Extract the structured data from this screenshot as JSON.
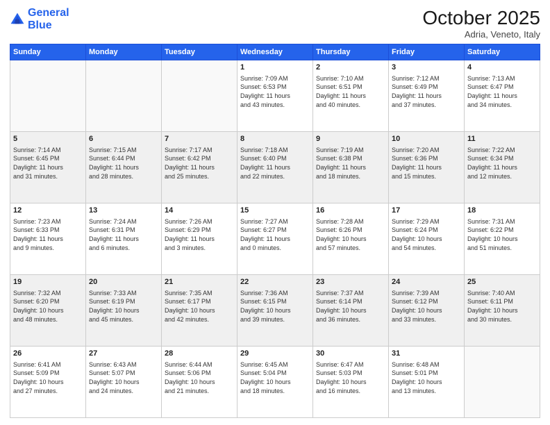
{
  "header": {
    "logo_line1": "General",
    "logo_line2": "Blue",
    "month": "October 2025",
    "location": "Adria, Veneto, Italy"
  },
  "days_of_week": [
    "Sunday",
    "Monday",
    "Tuesday",
    "Wednesday",
    "Thursday",
    "Friday",
    "Saturday"
  ],
  "weeks": [
    [
      {
        "day": "",
        "info": ""
      },
      {
        "day": "",
        "info": ""
      },
      {
        "day": "",
        "info": ""
      },
      {
        "day": "1",
        "info": "Sunrise: 7:09 AM\nSunset: 6:53 PM\nDaylight: 11 hours\nand 43 minutes."
      },
      {
        "day": "2",
        "info": "Sunrise: 7:10 AM\nSunset: 6:51 PM\nDaylight: 11 hours\nand 40 minutes."
      },
      {
        "day": "3",
        "info": "Sunrise: 7:12 AM\nSunset: 6:49 PM\nDaylight: 11 hours\nand 37 minutes."
      },
      {
        "day": "4",
        "info": "Sunrise: 7:13 AM\nSunset: 6:47 PM\nDaylight: 11 hours\nand 34 minutes."
      }
    ],
    [
      {
        "day": "5",
        "info": "Sunrise: 7:14 AM\nSunset: 6:45 PM\nDaylight: 11 hours\nand 31 minutes."
      },
      {
        "day": "6",
        "info": "Sunrise: 7:15 AM\nSunset: 6:44 PM\nDaylight: 11 hours\nand 28 minutes."
      },
      {
        "day": "7",
        "info": "Sunrise: 7:17 AM\nSunset: 6:42 PM\nDaylight: 11 hours\nand 25 minutes."
      },
      {
        "day": "8",
        "info": "Sunrise: 7:18 AM\nSunset: 6:40 PM\nDaylight: 11 hours\nand 22 minutes."
      },
      {
        "day": "9",
        "info": "Sunrise: 7:19 AM\nSunset: 6:38 PM\nDaylight: 11 hours\nand 18 minutes."
      },
      {
        "day": "10",
        "info": "Sunrise: 7:20 AM\nSunset: 6:36 PM\nDaylight: 11 hours\nand 15 minutes."
      },
      {
        "day": "11",
        "info": "Sunrise: 7:22 AM\nSunset: 6:34 PM\nDaylight: 11 hours\nand 12 minutes."
      }
    ],
    [
      {
        "day": "12",
        "info": "Sunrise: 7:23 AM\nSunset: 6:33 PM\nDaylight: 11 hours\nand 9 minutes."
      },
      {
        "day": "13",
        "info": "Sunrise: 7:24 AM\nSunset: 6:31 PM\nDaylight: 11 hours\nand 6 minutes."
      },
      {
        "day": "14",
        "info": "Sunrise: 7:26 AM\nSunset: 6:29 PM\nDaylight: 11 hours\nand 3 minutes."
      },
      {
        "day": "15",
        "info": "Sunrise: 7:27 AM\nSunset: 6:27 PM\nDaylight: 11 hours\nand 0 minutes."
      },
      {
        "day": "16",
        "info": "Sunrise: 7:28 AM\nSunset: 6:26 PM\nDaylight: 10 hours\nand 57 minutes."
      },
      {
        "day": "17",
        "info": "Sunrise: 7:29 AM\nSunset: 6:24 PM\nDaylight: 10 hours\nand 54 minutes."
      },
      {
        "day": "18",
        "info": "Sunrise: 7:31 AM\nSunset: 6:22 PM\nDaylight: 10 hours\nand 51 minutes."
      }
    ],
    [
      {
        "day": "19",
        "info": "Sunrise: 7:32 AM\nSunset: 6:20 PM\nDaylight: 10 hours\nand 48 minutes."
      },
      {
        "day": "20",
        "info": "Sunrise: 7:33 AM\nSunset: 6:19 PM\nDaylight: 10 hours\nand 45 minutes."
      },
      {
        "day": "21",
        "info": "Sunrise: 7:35 AM\nSunset: 6:17 PM\nDaylight: 10 hours\nand 42 minutes."
      },
      {
        "day": "22",
        "info": "Sunrise: 7:36 AM\nSunset: 6:15 PM\nDaylight: 10 hours\nand 39 minutes."
      },
      {
        "day": "23",
        "info": "Sunrise: 7:37 AM\nSunset: 6:14 PM\nDaylight: 10 hours\nand 36 minutes."
      },
      {
        "day": "24",
        "info": "Sunrise: 7:39 AM\nSunset: 6:12 PM\nDaylight: 10 hours\nand 33 minutes."
      },
      {
        "day": "25",
        "info": "Sunrise: 7:40 AM\nSunset: 6:11 PM\nDaylight: 10 hours\nand 30 minutes."
      }
    ],
    [
      {
        "day": "26",
        "info": "Sunrise: 6:41 AM\nSunset: 5:09 PM\nDaylight: 10 hours\nand 27 minutes."
      },
      {
        "day": "27",
        "info": "Sunrise: 6:43 AM\nSunset: 5:07 PM\nDaylight: 10 hours\nand 24 minutes."
      },
      {
        "day": "28",
        "info": "Sunrise: 6:44 AM\nSunset: 5:06 PM\nDaylight: 10 hours\nand 21 minutes."
      },
      {
        "day": "29",
        "info": "Sunrise: 6:45 AM\nSunset: 5:04 PM\nDaylight: 10 hours\nand 18 minutes."
      },
      {
        "day": "30",
        "info": "Sunrise: 6:47 AM\nSunset: 5:03 PM\nDaylight: 10 hours\nand 16 minutes."
      },
      {
        "day": "31",
        "info": "Sunrise: 6:48 AM\nSunset: 5:01 PM\nDaylight: 10 hours\nand 13 minutes."
      },
      {
        "day": "",
        "info": ""
      }
    ]
  ]
}
